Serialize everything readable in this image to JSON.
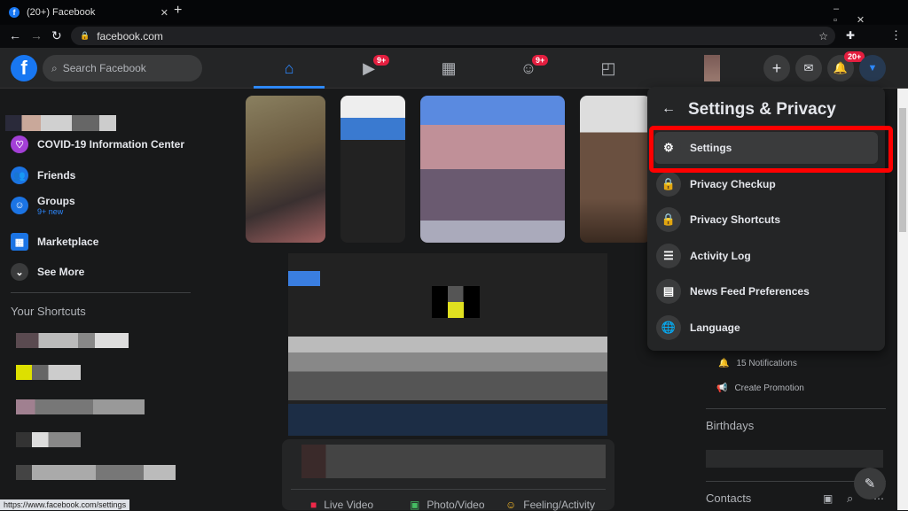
{
  "browser": {
    "tab_title": "(20+) Facebook",
    "url": "facebook.com",
    "status_url": "https://www.facebook.com/settings"
  },
  "nav": {
    "search_placeholder": "Search Facebook",
    "watch_badge": "9+",
    "groups_badge": "9+",
    "notif_badge": "20+",
    "accent": "#2d88ff"
  },
  "sidebar": {
    "items": [
      {
        "label": "COVID-19 Information Center",
        "icon": "shield-heart-icon"
      },
      {
        "label": "Friends",
        "icon": "friends-icon"
      },
      {
        "label": "Groups",
        "sub": "9+ new",
        "icon": "groups-icon"
      },
      {
        "label": "Marketplace",
        "icon": "shop-icon"
      },
      {
        "label": "See More",
        "icon": "chevron-down-icon"
      }
    ],
    "shortcuts_title": "Your Shortcuts"
  },
  "menu": {
    "title": "Settings & Privacy",
    "items": [
      {
        "label": "Settings",
        "icon": "gear-icon"
      },
      {
        "label": "Privacy Checkup",
        "icon": "lock-plus-icon"
      },
      {
        "label": "Privacy Shortcuts",
        "icon": "lock-icon"
      },
      {
        "label": "Activity Log",
        "icon": "list-icon"
      },
      {
        "label": "News Feed Preferences",
        "icon": "feed-icon"
      },
      {
        "label": "Language",
        "icon": "globe-icon"
      }
    ],
    "highlight_color": "#ff0000"
  },
  "right": {
    "notifications": "15 Notifications",
    "create_promotion": "Create Promotion",
    "birthdays": "Birthdays",
    "contacts": "Contacts"
  },
  "composer": {
    "live": "Live Video",
    "photo": "Photo/Video",
    "feeling": "Feeling/Activity"
  }
}
